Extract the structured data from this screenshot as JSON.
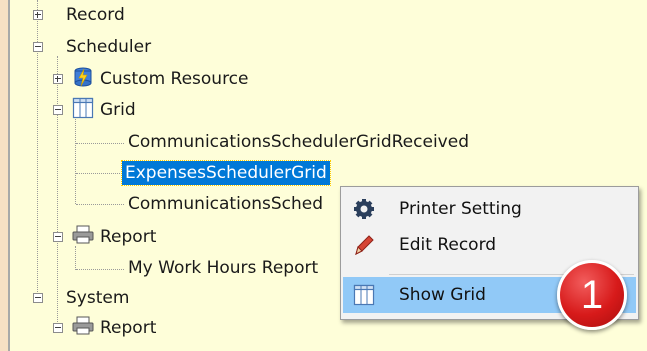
{
  "tree": {
    "record": "Record",
    "scheduler": "Scheduler",
    "custom_resource": "Custom Resource",
    "grid": "Grid",
    "grid_item_1": "CommunicationsSchedulerGridReceived",
    "grid_item_2": "ExpensesSchedulerGrid",
    "grid_item_3": "CommunicationsSched",
    "report": "Report",
    "report_item_1": "My Work Hours Report",
    "system": "System",
    "system_report": "Report"
  },
  "context_menu": {
    "printer_setting": "Printer Setting",
    "edit_record": "Edit Record",
    "show_grid": "Show Grid"
  },
  "callout": {
    "number": "1"
  },
  "colors": {
    "selection": "#0078d7",
    "menu_hover": "#91c9f7",
    "badge": "#d71a1a"
  }
}
